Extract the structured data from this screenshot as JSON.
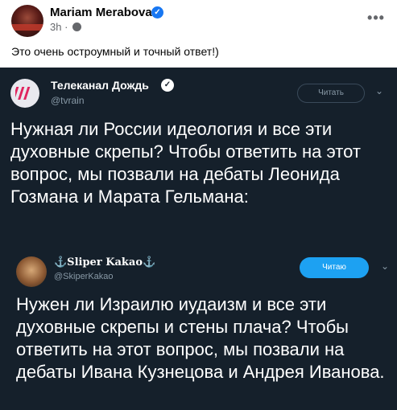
{
  "post": {
    "author": "Mariam Merabova",
    "time": "3h",
    "more": "•••",
    "text": "Это очень остроумный и точный ответ!)"
  },
  "tweet1": {
    "name": "Телеканал Дождь",
    "handle": "@tvrain",
    "follow_label": "Читать",
    "text": "Нужная ли России идеология и все эти духовные скрепы? Чтобы ответить на этот вопрос, мы позвали на дебаты Леонида Гозмана и Марата Гельмана:"
  },
  "tweet2": {
    "name": "⚓Sliper Kakao⚓",
    "handle": "@SkiperKakao",
    "follow_label": "Читаю",
    "text": "Нужен ли Израилю иудаизм и все эти духовные скрепы и стены плача? Чтобы ответить на этот вопрос, мы позвали на дебаты Ивана Кузнецова и Андрея Иванова."
  },
  "colors": {
    "facebook_blue": "#1877f2",
    "twitter_dark_bg": "#15202b",
    "twitter_blue": "#1da1f2"
  },
  "icons": {
    "verified": "verified-badge-icon",
    "globe": "globe-icon",
    "more": "more-options-icon",
    "chevron": "chevron-down-icon",
    "tvrain_logo": "tvrain-logo"
  }
}
